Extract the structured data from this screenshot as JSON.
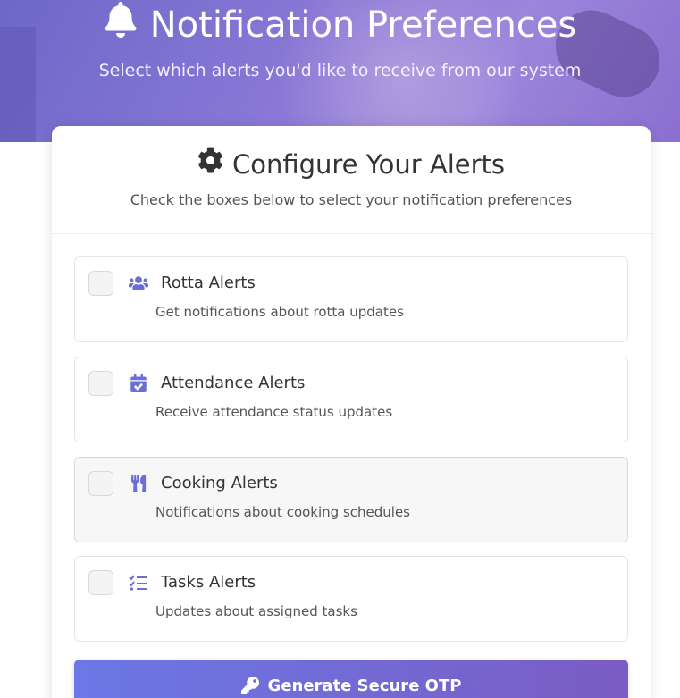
{
  "hero": {
    "title": "Notification Preferences",
    "subtitle": "Select which alerts you'd like to receive from our system",
    "icon": "bell-icon"
  },
  "card": {
    "title": "Configure Your Alerts",
    "subtitle": "Check the boxes below to select your notification preferences",
    "icon": "gear-icon"
  },
  "alerts": [
    {
      "label": "Rotta Alerts",
      "description": "Get notifications about rotta updates",
      "icon": "users-icon",
      "checked": false
    },
    {
      "label": "Attendance Alerts",
      "description": "Receive attendance status updates",
      "icon": "calendar-check-icon",
      "checked": false
    },
    {
      "label": "Cooking Alerts",
      "description": "Notifications about cooking schedules",
      "icon": "utensils-icon",
      "checked": false
    },
    {
      "label": "Tasks Alerts",
      "description": "Updates about assigned tasks",
      "icon": "task-list-icon",
      "checked": false
    }
  ],
  "button": {
    "label": "Generate Secure OTP",
    "icon": "key-icon"
  },
  "colors": {
    "accent": "#6b78e6",
    "accent_end": "#7b5cc4",
    "icon": "#6a6fd6"
  }
}
